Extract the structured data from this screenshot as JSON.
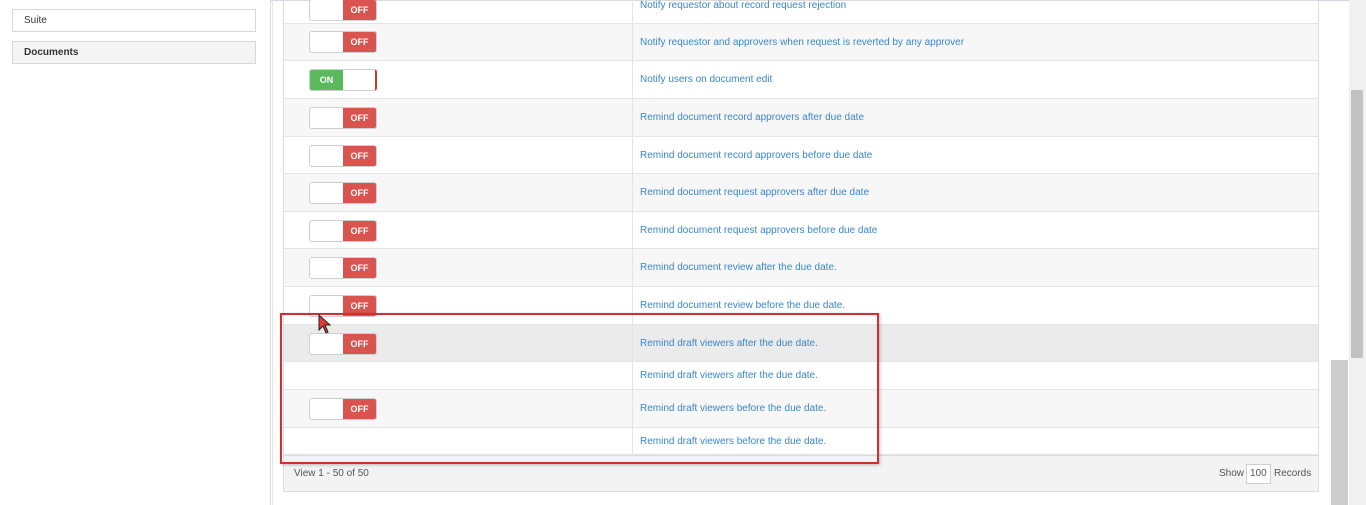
{
  "sidebar": {
    "items": [
      {
        "label": "Suite",
        "active": false
      },
      {
        "label": "Documents",
        "active": true
      }
    ]
  },
  "rows": [
    {
      "toggle": "OFF",
      "description": "Notify requestor about record request rejection"
    },
    {
      "toggle": "OFF",
      "description": "Notify requestor and approvers when request is reverted by any approver"
    },
    {
      "toggle": "ON",
      "description": "Notify users on document edit"
    },
    {
      "toggle": "OFF",
      "description": "Remind document record approvers after due date"
    },
    {
      "toggle": "OFF",
      "description": "Remind document record approvers before due date"
    },
    {
      "toggle": "OFF",
      "description": "Remind document request approvers after due date"
    },
    {
      "toggle": "OFF",
      "description": "Remind document request approvers before due date"
    },
    {
      "toggle": "OFF",
      "description": "Remind document review after the due date."
    },
    {
      "toggle": "OFF",
      "description": "Remind document review before the due date."
    },
    {
      "toggle": "OFF",
      "description": "Remind draft viewers after the due date."
    },
    {
      "toggle": "",
      "description": "Remind draft viewers after the due date."
    },
    {
      "toggle": "OFF",
      "description": "Remind draft viewers before the due date."
    },
    {
      "toggle": "",
      "description": "Remind draft viewers before the due date."
    }
  ],
  "footer": {
    "view_text": "View 1 - 50 of 50",
    "show_label": "Show",
    "show_value": "100",
    "records_label": "Records"
  },
  "colors": {
    "off": "#d9534f",
    "on": "#5cb85c",
    "link": "#3a87c8",
    "highlight": "#d32f2f"
  }
}
